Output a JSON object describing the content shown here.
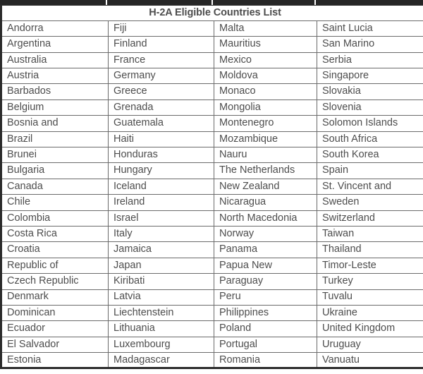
{
  "document": {
    "title": "H-2A Eligible Countries List",
    "top_strip_segments": 4,
    "colors": {
      "text": "#4d4d4d",
      "title_text": "#1a1a1a",
      "grid_border": "#6b6b6b",
      "outer_border": "#2b2b2b",
      "strip": "#262626",
      "background": "#ffffff"
    }
  },
  "table": {
    "column_count": 4,
    "row_count": 22,
    "rows": [
      [
        "Andorra",
        "Fiji",
        "Malta",
        "Saint Lucia"
      ],
      [
        "Argentina",
        "Finland",
        "Mauritius",
        "San Marino"
      ],
      [
        "Australia",
        "France",
        "Mexico",
        "Serbia"
      ],
      [
        "Austria",
        "Germany",
        "Moldova",
        "Singapore"
      ],
      [
        "Barbados",
        "Greece",
        "Monaco",
        "Slovakia"
      ],
      [
        "Belgium",
        "Grenada",
        "Mongolia",
        "Slovenia"
      ],
      [
        "Bosnia and",
        "Guatemala",
        "Montenegro",
        "Solomon Islands"
      ],
      [
        "Brazil",
        "Haiti",
        "Mozambique",
        "South Africa"
      ],
      [
        "Brunei",
        "Honduras",
        "Nauru",
        "South Korea"
      ],
      [
        "Bulgaria",
        "Hungary",
        "The Netherlands",
        "Spain"
      ],
      [
        "Canada",
        "Iceland",
        "New Zealand",
        "St. Vincent and"
      ],
      [
        "Chile",
        "Ireland",
        "Nicaragua",
        "Sweden"
      ],
      [
        "Colombia",
        "Israel",
        "North Macedonia",
        "Switzerland"
      ],
      [
        "Costa Rica",
        "Italy",
        "Norway",
        "Taiwan"
      ],
      [
        "Croatia",
        "Jamaica",
        "Panama",
        "Thailand"
      ],
      [
        "Republic of",
        "Japan",
        "Papua New",
        "Timor-Leste"
      ],
      [
        "Czech Republic",
        "Kiribati",
        "Paraguay",
        "Turkey"
      ],
      [
        "Denmark",
        "Latvia",
        "Peru",
        "Tuvalu"
      ],
      [
        "Dominican",
        "Liechtenstein",
        "Philippines",
        "Ukraine"
      ],
      [
        "Ecuador",
        "Lithuania",
        "Poland",
        "United Kingdom"
      ],
      [
        "El Salvador",
        "Luxembourg",
        "Portugal",
        "Uruguay"
      ],
      [
        "Estonia",
        "Madagascar",
        "Romania",
        "Vanuatu"
      ]
    ]
  }
}
